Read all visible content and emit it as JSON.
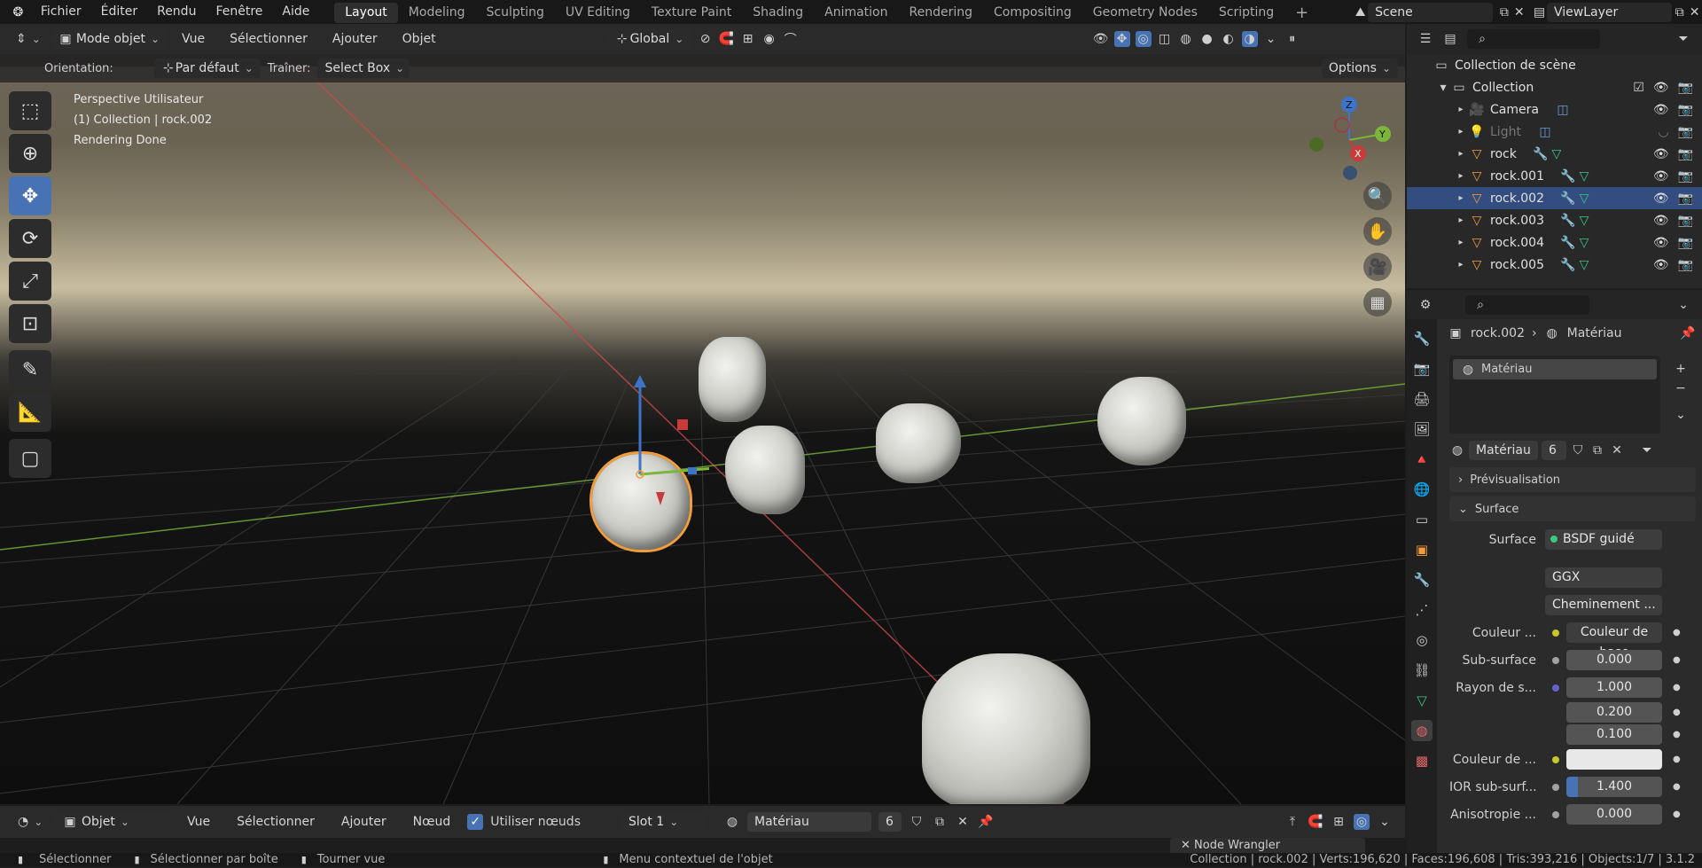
{
  "topbar": {
    "menus": [
      "Fichier",
      "Éditer",
      "Rendu",
      "Fenêtre",
      "Aide"
    ],
    "workspaces": [
      "Layout",
      "Modeling",
      "Sculpting",
      "UV Editing",
      "Texture Paint",
      "Shading",
      "Animation",
      "Rendering",
      "Compositing",
      "Geometry Nodes",
      "Scripting"
    ],
    "active_workspace": "Layout",
    "add_tab": "+",
    "scene": "Scene",
    "view_layer": "ViewLayer"
  },
  "viewport_header": {
    "mode": "Mode objet",
    "menus": [
      "Vue",
      "Sélectionner",
      "Ajouter",
      "Objet"
    ],
    "transform": "Global"
  },
  "tool_settings": {
    "orientation_label": "Orientation:",
    "orientation_value": "Par défaut",
    "drag_label": "Traîner:",
    "drag_value": "Select Box",
    "options": "Options"
  },
  "viewport_info": {
    "line1": "Perspective Utilisateur",
    "line2": "(1) Collection | rock.002",
    "line3": "Rendering Done"
  },
  "gizmo": {
    "z": "Z",
    "y": "Y",
    "x": "X"
  },
  "outliner": {
    "scene_collection": "Collection de scène",
    "collection": "Collection",
    "items": [
      {
        "name": "Camera",
        "selected": false,
        "dim": false
      },
      {
        "name": "Light",
        "selected": false,
        "dim": true
      },
      {
        "name": "rock",
        "selected": false,
        "dim": false
      },
      {
        "name": "rock.001",
        "selected": false,
        "dim": false
      },
      {
        "name": "rock.002",
        "selected": true,
        "dim": false
      },
      {
        "name": "rock.003",
        "selected": false,
        "dim": false
      },
      {
        "name": "rock.004",
        "selected": false,
        "dim": false
      },
      {
        "name": "rock.005",
        "selected": false,
        "dim": false
      }
    ]
  },
  "properties": {
    "breadcrumb_object": "rock.002",
    "breadcrumb_tab": "Matériau",
    "slot_name": "Matériau",
    "material_name": "Matériau",
    "material_users": "6",
    "panel_preview": "Prévisualisation",
    "panel_surface": "Surface",
    "surface_label": "Surface",
    "surface_value": "BSDF guidé",
    "distribution": "GGX",
    "subsurface_method": "Cheminement ...",
    "rows": [
      {
        "label": "Couleur ...",
        "value": "Couleur de base",
        "dot": "#c7c729"
      },
      {
        "label": "Sub-surface",
        "value": "0.000",
        "dot": "#a1a1a1"
      },
      {
        "label": "Rayon de s...",
        "value": "1.000",
        "dot": "#6363c7"
      },
      {
        "label": "",
        "value": "0.200",
        "dot": ""
      },
      {
        "label": "",
        "value": "0.100",
        "dot": ""
      },
      {
        "label": "Couleur de ...",
        "value": "",
        "dot": "#c7c729"
      },
      {
        "label": "IOR sub-surf...",
        "value": "1.400",
        "dot": "#a1a1a1"
      },
      {
        "label": "Anisotropie ...",
        "value": "0.000",
        "dot": "#a1a1a1"
      }
    ]
  },
  "node_header": {
    "editor_type": "Objet",
    "menus": [
      "Vue",
      "Sélectionner",
      "Ajouter",
      "Nœud"
    ],
    "use_nodes": "Utiliser nœuds",
    "slot": "Slot 1",
    "material": "Matériau",
    "users": "6",
    "sidebar_panel": "Node Wrangler"
  },
  "statusbar": {
    "select": "Sélectionner",
    "box_select": "Sélectionner par boîte",
    "rotate": "Tourner vue",
    "context_menu": "Menu contextuel de l'objet",
    "stats": "Collection | rock.002 | Verts:196,620 | Faces:196,608 | Tris:393,216 | Objects:1/7 | 3.1.2"
  },
  "colors": {
    "accent": "#4772b3",
    "selection": "#334d80",
    "active_outline": "#f29d3c",
    "axis_x": "#c93a3a",
    "axis_y": "#7bb539",
    "axis_z": "#3b74c9"
  }
}
